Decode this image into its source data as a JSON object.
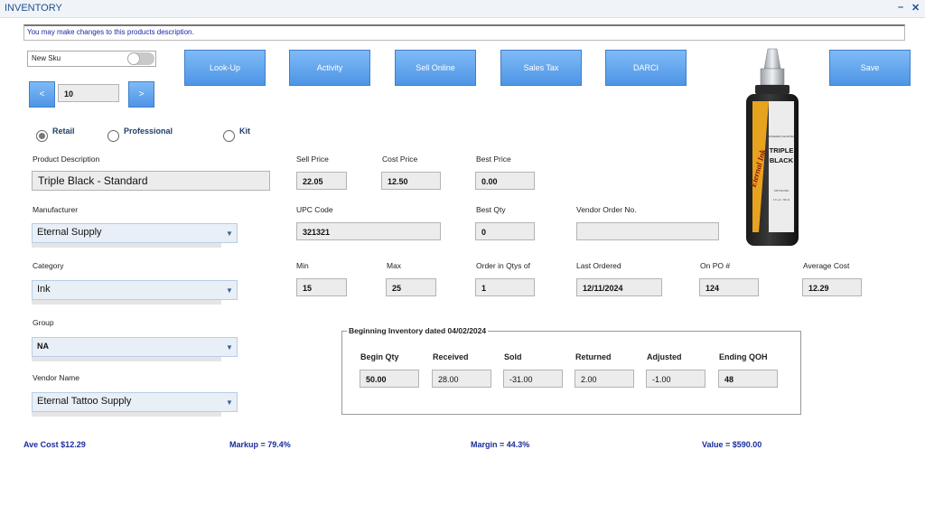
{
  "window": {
    "title": "INVENTORY",
    "minimize": "–",
    "close": "✕"
  },
  "note": "You may make changes to this products description.",
  "new_sku": {
    "label": "New Sku",
    "checked": false
  },
  "nav": {
    "prev": "<",
    "next": ">",
    "index": "10"
  },
  "toolbar": {
    "lookup": "Look-Up",
    "activity": "Activity",
    "sell_online": "Sell Online",
    "sales_tax": "Sales Tax",
    "darci": "DARCI",
    "save": "Save"
  },
  "pricing_type": {
    "options": [
      "Retail",
      "Professional",
      "Kit"
    ],
    "selected": "Retail"
  },
  "product_image": {
    "brand": "Eternal Ink",
    "name_line1": "TRIPLE",
    "name_line2": "BLACK",
    "header": "STANDARD COLOR HEX",
    "tag": "TATTOO INK",
    "volume": "1 fl. oz. / 30 ml"
  },
  "fields": {
    "product_description": {
      "label": "Product Description",
      "value": "Triple Black - Standard"
    },
    "sell_price": {
      "label": "Sell Price",
      "value": "22.05"
    },
    "cost_price": {
      "label": "Cost Price",
      "value": "12.50"
    },
    "best_price": {
      "label": "Best Price",
      "value": "0.00"
    },
    "manufacturer": {
      "label": "Manufacturer",
      "value": "Eternal Supply"
    },
    "upc_code": {
      "label": "UPC Code",
      "value": "321321"
    },
    "best_qty": {
      "label": "Best Qty",
      "value": "0"
    },
    "vendor_order_no": {
      "label": "Vendor Order No.",
      "value": ""
    },
    "category": {
      "label": "Category",
      "value": "Ink"
    },
    "min": {
      "label": "Min",
      "value": "15"
    },
    "max": {
      "label": "Max",
      "value": "25"
    },
    "order_in_qtys_of": {
      "label": "Order in Qtys of",
      "value": "1"
    },
    "last_ordered": {
      "label": "Last Ordered",
      "value": "12/11/2024"
    },
    "on_po": {
      "label": "On PO #",
      "value": "124"
    },
    "average_cost": {
      "label": "Average Cost",
      "value": "12.29"
    },
    "group": {
      "label": "Group",
      "value": "NA"
    },
    "vendor_name": {
      "label": "Vendor Name",
      "value": "Eternal Tattoo Supply"
    }
  },
  "beginning_inventory": {
    "title": "Beginning Inventory dated 04/02/2024",
    "begin_qty": {
      "label": "Begin Qty",
      "value": "50.00"
    },
    "received": {
      "label": "Received",
      "value": "28.00"
    },
    "sold": {
      "label": "Sold",
      "value": "-31.00"
    },
    "returned": {
      "label": "Returned",
      "value": "2.00"
    },
    "adjusted": {
      "label": "Adjusted",
      "value": "-1.00"
    },
    "ending_qoh": {
      "label": "Ending QOH",
      "value": "48"
    }
  },
  "summary": {
    "ave_cost": "Ave Cost $12.29",
    "markup": "Markup = 79.4%",
    "margin": "Margin = 44.3%",
    "value": "Value = $590.00"
  },
  "colors": {
    "accent": "#5a9fe9",
    "title_text": "#1d4f8a",
    "summary_text": "#1a2d9a"
  }
}
